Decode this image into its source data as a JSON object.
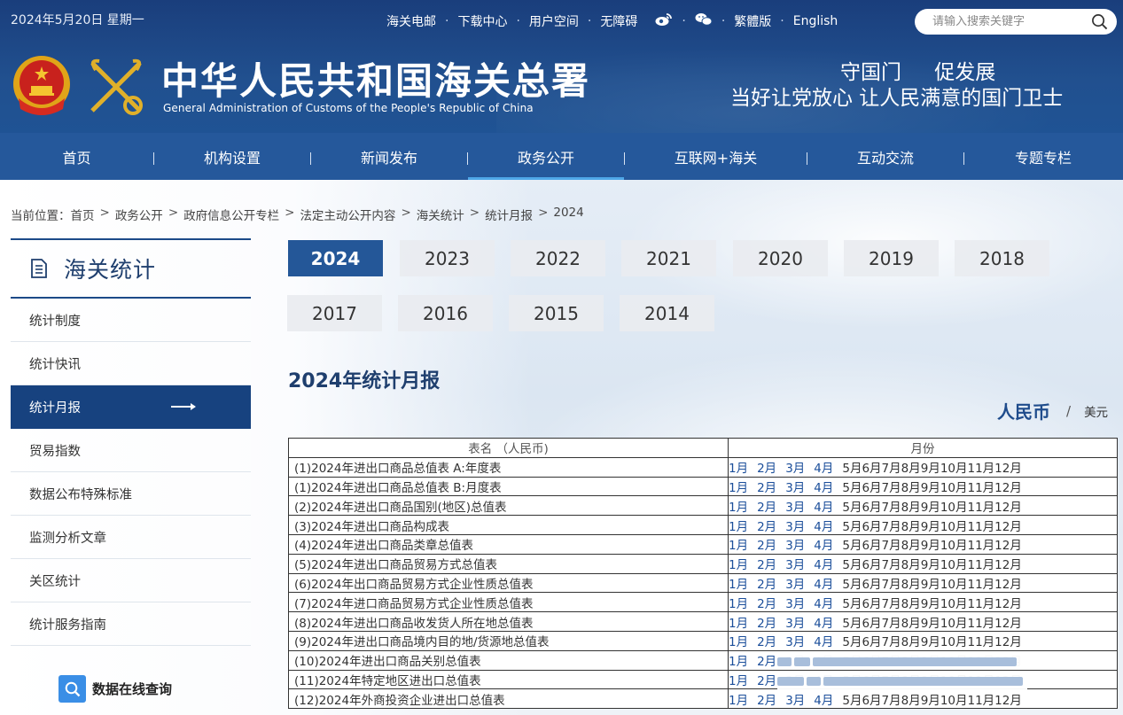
{
  "header": {
    "date": "2024年5月20日 星期一",
    "top_links": [
      "海关电邮",
      "下载中心",
      "用户空间",
      "无障碍"
    ],
    "weibo_icon": "weibo-icon",
    "wechat_icon": "wechat-icon",
    "traditional": "繁體版",
    "english": "English",
    "search_placeholder": "请输入搜索关键字",
    "site_title": "中华人民共和国海关总署",
    "site_subtitle": "General Administration of Customs of the People's Republic of China",
    "slogan_line1": "守国门 促发展",
    "slogan_line2": "当好让党放心 让人民满意的国门卫士"
  },
  "nav": {
    "items": [
      "首页",
      "机构设置",
      "新闻发布",
      "政务公开",
      "互联网+海关",
      "互动交流",
      "专题专栏"
    ],
    "active": "政务公开"
  },
  "breadcrumb": {
    "lead": "当前位置：",
    "items": [
      "首页",
      "政务公开",
      "政府信息公开专栏",
      "法定主动公开内容",
      "海关统计",
      "统计月报",
      "2024"
    ],
    "separator": ">"
  },
  "sidebar": {
    "title": "海关统计",
    "items": [
      "统计制度",
      "统计快讯",
      "统计月报",
      "贸易指数",
      "数据公布特殊标准",
      "监测分析文章",
      "关区统计",
      "统计服务指南"
    ],
    "active": "统计月报",
    "query_label": "数据在线查询"
  },
  "years": [
    "2024",
    "2023",
    "2022",
    "2021",
    "2020",
    "2019",
    "2018",
    "2017",
    "2016",
    "2015",
    "2014"
  ],
  "active_year": "2024",
  "page_heading": "2024年统计月报",
  "currency": {
    "rmb": "人民币",
    "sep": "/",
    "usd": "美元"
  },
  "table": {
    "headers": [
      "表名 （人民币)",
      "月份"
    ],
    "linked_months": [
      "1月",
      "2月",
      "3月",
      "4月"
    ],
    "plain_months": "5月6月7月8月9月10月11月12月",
    "rows": [
      "(1)2024年进出口商品总值表 A:年度表",
      "(1)2024年进出口商品总值表 B:月度表",
      "(2)2024年进出口商品国别(地区)总值表",
      "(3)2024年进出口商品构成表",
      "(4)2024年进出口商品类章总值表",
      "(5)2024年进出口商品贸易方式总值表",
      "(6)2024年出口商品贸易方式企业性质总值表",
      "(7)2024年进口商品贸易方式企业性质总值表",
      "(8)2024年进出口商品收发货人所在地总值表",
      "(9)2024年进出口商品境内目的地/货源地总值表",
      "(10)2024年进出口商品关别总值表",
      "(11)2024年特定地区进出口总值表",
      "(12)2024年外商投资企业进出口总值表"
    ]
  },
  "colors": {
    "header_blue": "#1f4c8c",
    "nav_blue": "#25589b",
    "active_blue": "#17427f",
    "link_blue": "#1b4e9a"
  }
}
